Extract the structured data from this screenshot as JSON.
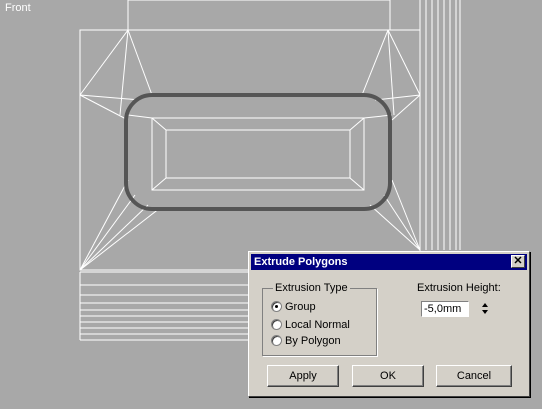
{
  "viewport": {
    "label": "Front"
  },
  "dialog": {
    "title": "Extrude Polygons",
    "close_label": "✕",
    "extrusion_type": {
      "legend": "Extrusion Type",
      "options": [
        "Group",
        "Local Normal",
        "By Polygon"
      ],
      "selected": "Group"
    },
    "extrusion_height": {
      "label": "Extrusion Height:",
      "value": "-5,0mm"
    },
    "buttons": {
      "apply": "Apply",
      "ok": "OK",
      "cancel": "Cancel"
    }
  }
}
